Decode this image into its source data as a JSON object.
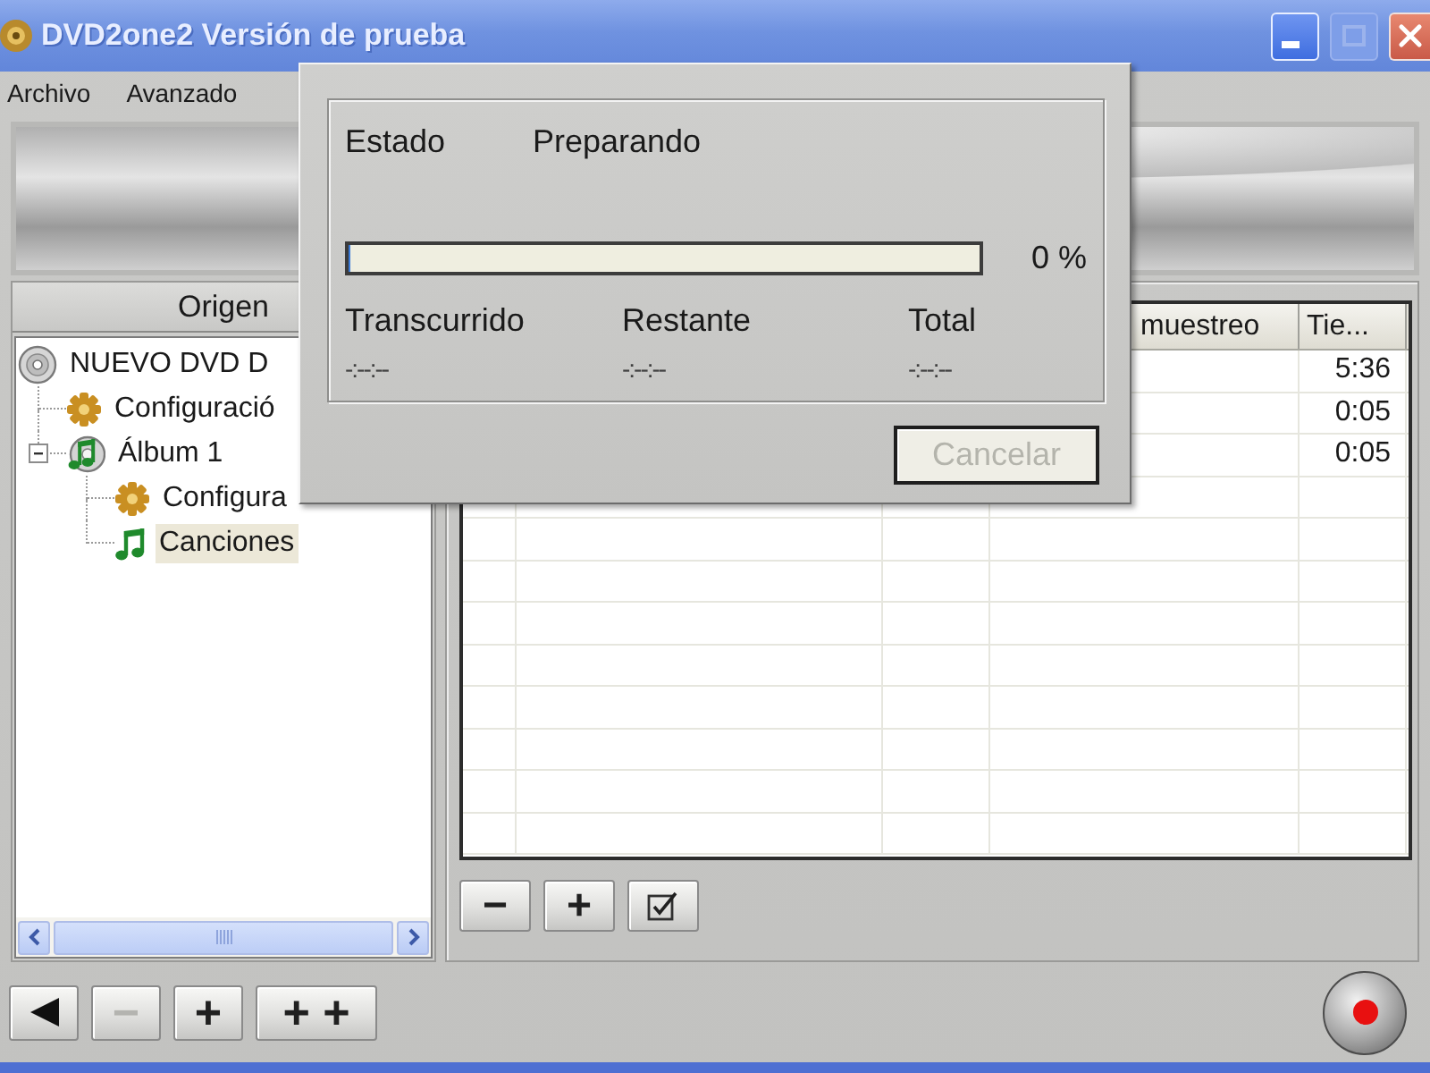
{
  "window": {
    "title": "DVD2one2 Versión de prueba",
    "buttons": [
      {
        "kind": "minimize",
        "disabled": false
      },
      {
        "kind": "maximize",
        "disabled": true
      },
      {
        "kind": "close",
        "disabled": false
      }
    ]
  },
  "menu": [
    "Archivo",
    "Avanzado"
  ],
  "source_panel": {
    "header": "Origen",
    "tree": [
      {
        "label": "NUEVO DVD D",
        "kind": "disc",
        "selected": false,
        "children": [
          {
            "label": "Configuració",
            "kind": "settings",
            "selected": false
          },
          {
            "label": "Álbum 1",
            "kind": "album",
            "selected": false,
            "expanded": true,
            "children": [
              {
                "label": "Configura",
                "kind": "settings",
                "selected": false
              },
              {
                "label": "Canciones",
                "kind": "songs",
                "selected": true
              }
            ]
          }
        ]
      }
    ]
  },
  "table": {
    "columns": [
      {
        "label": "muestreo"
      },
      {
        "label": "Tie..."
      }
    ],
    "rows": [
      {
        "column_5": "5:36"
      },
      {
        "column_5": "0:05"
      },
      {
        "column_5": "0:05"
      }
    ]
  },
  "table_buttons": [
    {
      "kind": "text",
      "label": "−"
    },
    {
      "kind": "text",
      "label": "+"
    },
    {
      "kind": "check"
    }
  ],
  "bottom_buttons": [
    {
      "kind": "back",
      "disabled": false
    },
    {
      "kind": "text",
      "label": "−",
      "disabled": true
    },
    {
      "kind": "text",
      "label": "+",
      "disabled": false
    },
    {
      "kind": "text",
      "label": "+ +",
      "disabled": false
    }
  ],
  "dialog": {
    "status_label": "Estado",
    "status_value": "Preparando",
    "progress": {
      "level": 0,
      "reading": "0 %"
    },
    "times": [
      {
        "label": "Transcurrido",
        "value": "-:--:--"
      },
      {
        "label": "Restante",
        "value": "-:--:--"
      },
      {
        "label": "Total",
        "value": "-:--:--"
      }
    ],
    "cancel_button": {
      "label": "Cancelar",
      "disabled": true
    }
  }
}
